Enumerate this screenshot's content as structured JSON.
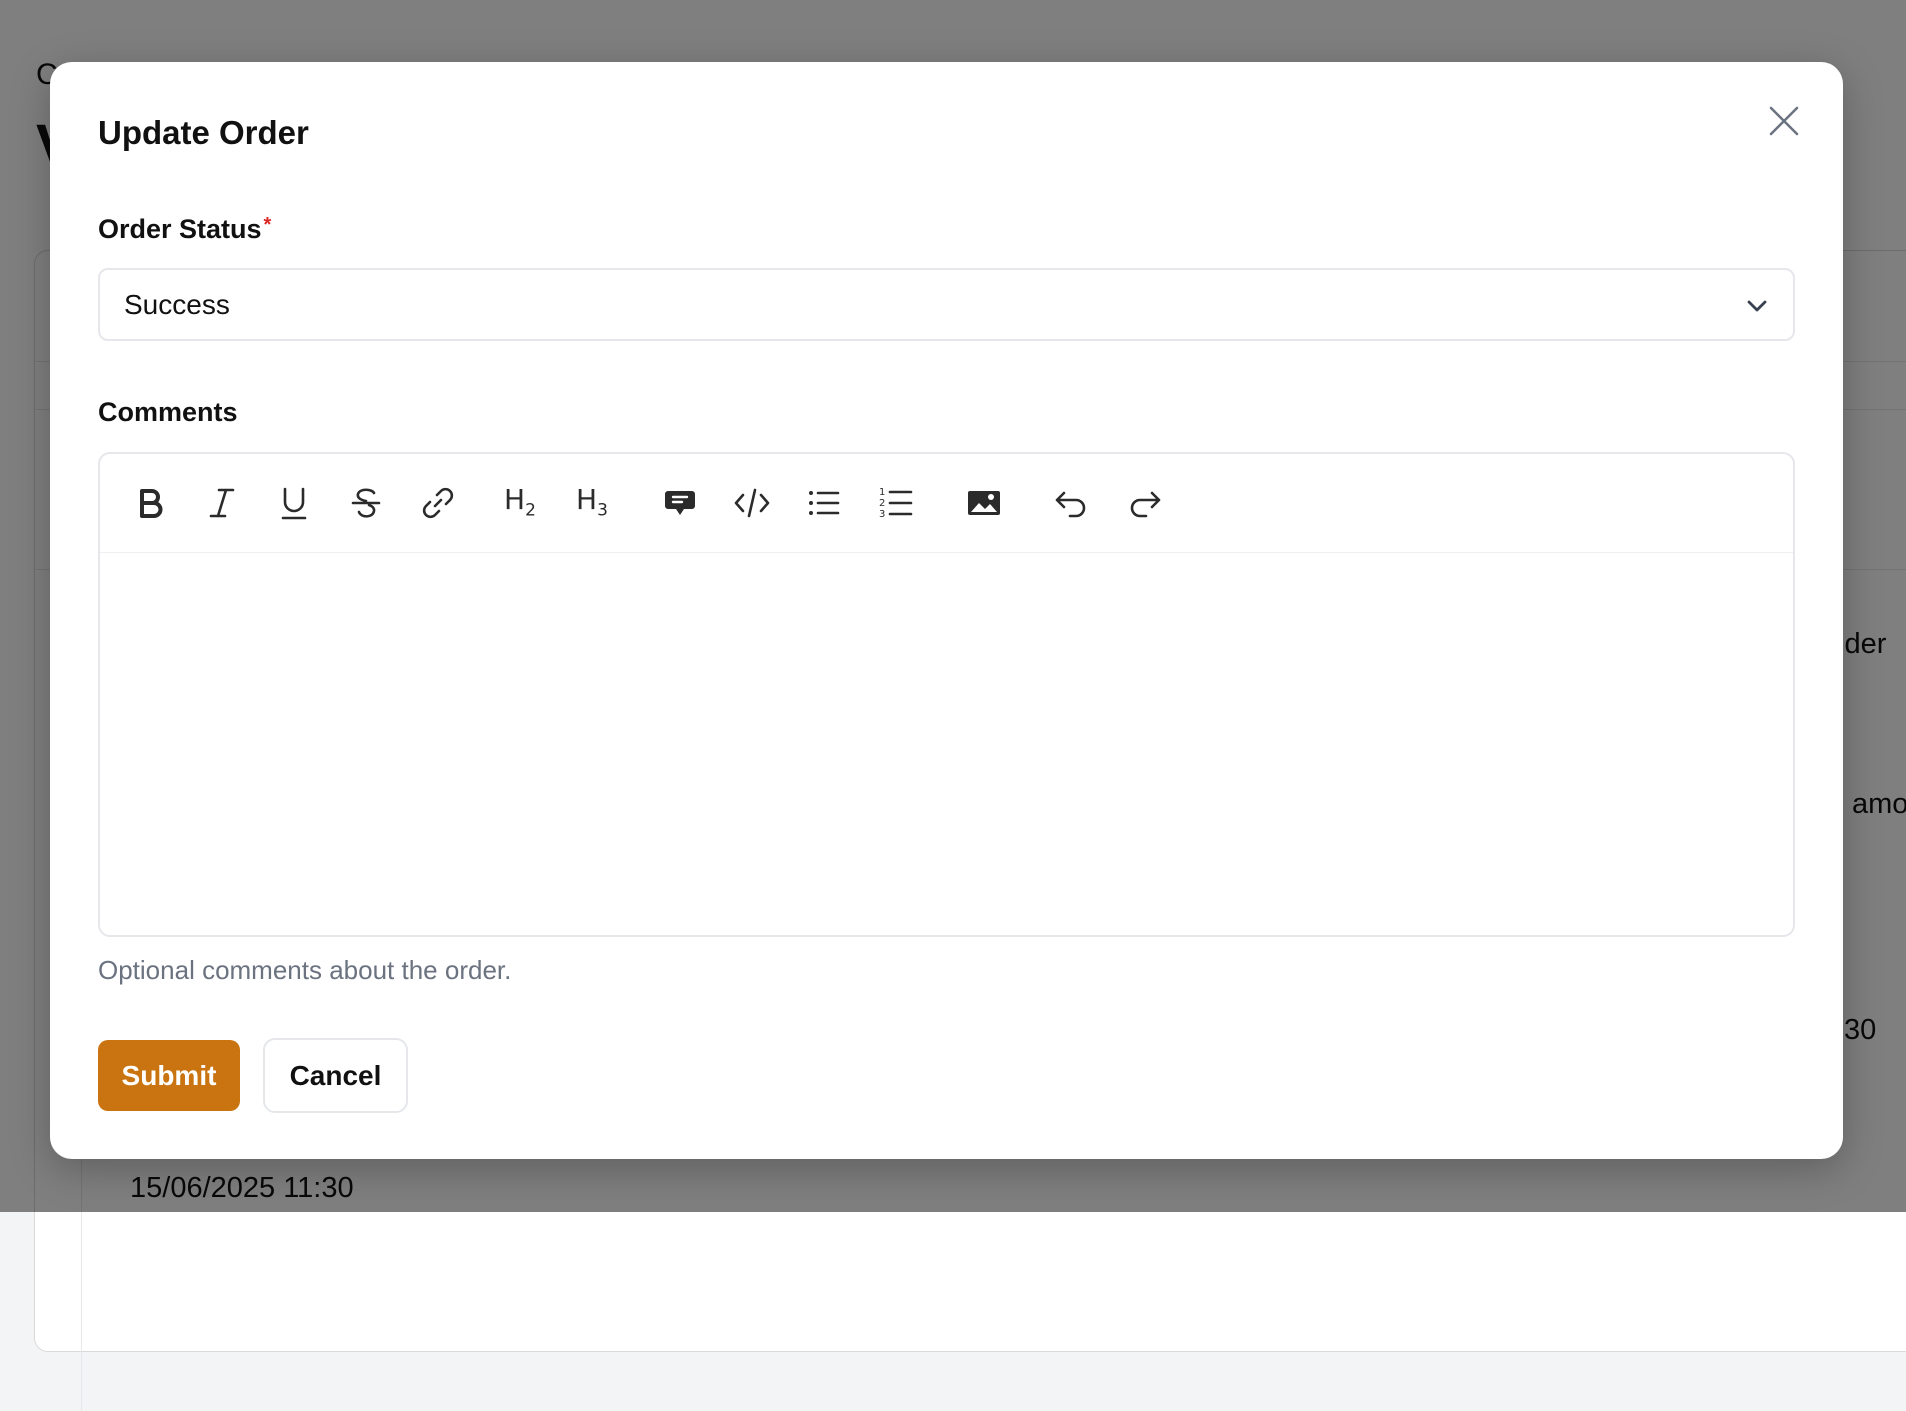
{
  "background": {
    "breadcrumb_fragment": "C",
    "title_fragment": "V",
    "right_text_1": "ider",
    "right_text_2": "amo",
    "right_text_3": ":30",
    "bottom_date": "15/06/2025 11:30"
  },
  "modal": {
    "title": "Update Order",
    "close_icon": "close-icon",
    "order_status": {
      "label": "Order Status",
      "required_mark": "*",
      "selected_value": "Success"
    },
    "comments": {
      "label": "Comments",
      "content": "",
      "hint": "Optional comments about the order."
    },
    "toolbar": [
      {
        "name": "bold",
        "icon": "bold-icon"
      },
      {
        "name": "italic",
        "icon": "italic-icon"
      },
      {
        "name": "underline",
        "icon": "underline-icon"
      },
      {
        "name": "strikethrough",
        "icon": "strikethrough-icon"
      },
      {
        "name": "link",
        "icon": "link-icon"
      },
      {
        "name": "heading-2",
        "icon": "heading-2-icon",
        "text": "H",
        "sub": "2"
      },
      {
        "name": "heading-3",
        "icon": "heading-3-icon",
        "text": "H",
        "sub": "3"
      },
      {
        "name": "blockquote",
        "icon": "quote-bubble-icon"
      },
      {
        "name": "code",
        "icon": "code-icon"
      },
      {
        "name": "bullet-list",
        "icon": "bullet-list-icon"
      },
      {
        "name": "ordered-list",
        "icon": "ordered-list-icon"
      },
      {
        "name": "image",
        "icon": "image-icon"
      },
      {
        "name": "undo",
        "icon": "undo-icon"
      },
      {
        "name": "redo",
        "icon": "redo-icon"
      }
    ],
    "buttons": {
      "submit_label": "Submit",
      "cancel_label": "Cancel"
    }
  },
  "colors": {
    "primary": "#c97410",
    "required": "#dc2626",
    "overlay": "rgba(0,0,0,0.5)"
  }
}
